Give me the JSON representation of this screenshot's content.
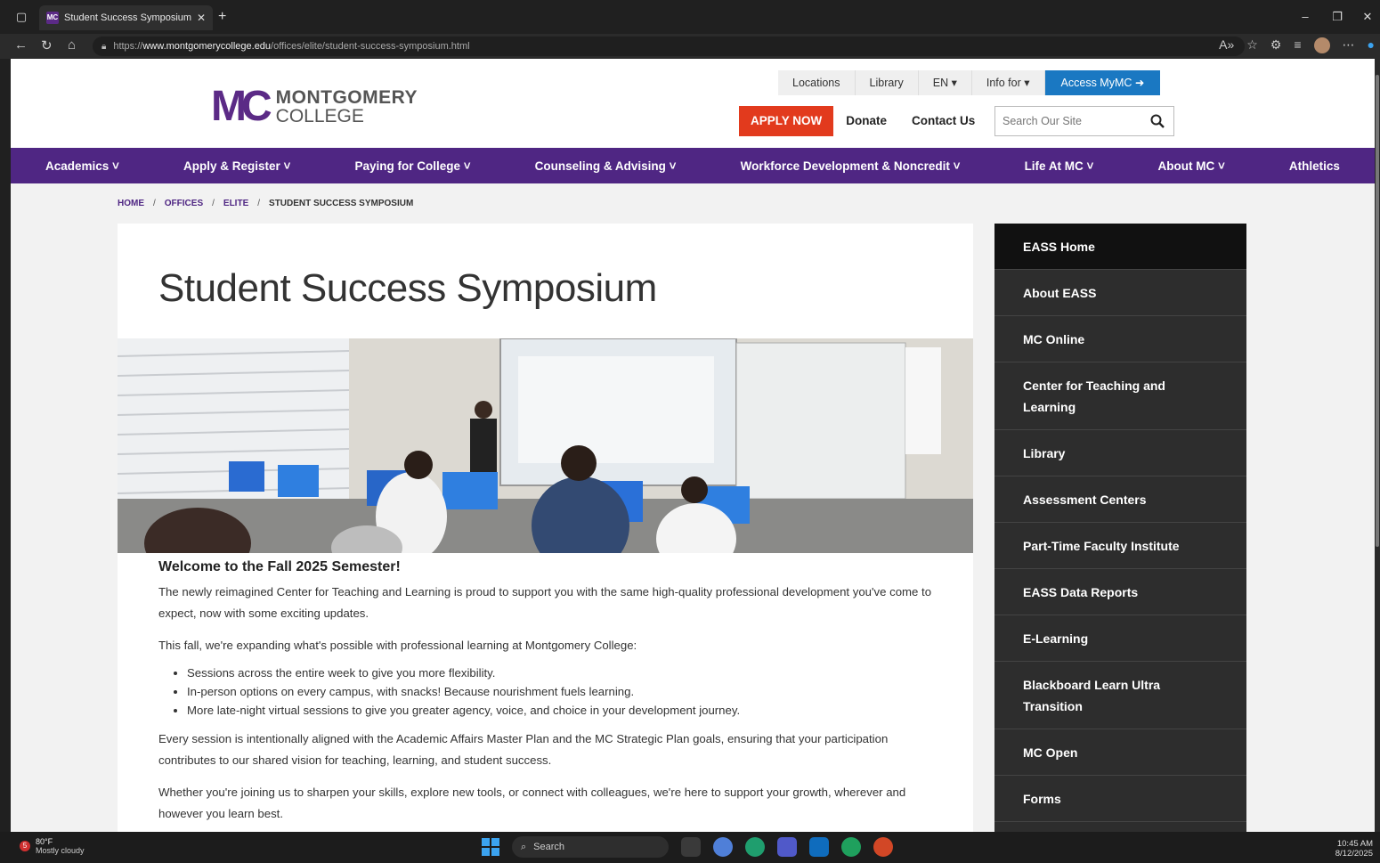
{
  "browser": {
    "tab_title": "Student Success Symposium | Mo",
    "url_prefix": "https://",
    "url_domain": "www.montgomerycollege.edu",
    "url_path": "/offices/elite/student-success-symposium.html"
  },
  "logo": {
    "mark": "MC",
    "line1": "MONTGOMERY",
    "line2": "COLLEGE"
  },
  "utility_nav": {
    "locations": "Locations",
    "library": "Library",
    "language": "EN ▾",
    "info_for": "Info for ▾",
    "access": "Access MyMC ➜"
  },
  "actions": {
    "apply": "APPLY NOW",
    "donate": "Donate",
    "contact": "Contact Us"
  },
  "search": {
    "placeholder": "Search Our Site"
  },
  "main_nav": [
    "Academics ˅",
    "Apply & Register ˅",
    "Paying for College ˅",
    "Counseling & Advising ˅",
    "Workforce Development & Noncredit ˅",
    "Life At MC ˅",
    "About MC ˅",
    "Athletics"
  ],
  "breadcrumb": {
    "home": "Home",
    "offices": "Offices",
    "elite": "ELITE",
    "current": "Student Success Symposium",
    "sep": "/"
  },
  "content": {
    "title": "Student Success Symposium",
    "heading": "Welcome to the Fall 2025 Semester!",
    "p1": "The newly reimagined Center for Teaching and Learning is proud to support you with the same high-quality professional development you've come to expect, now with some exciting updates.",
    "p2": "This fall, we're expanding what's possible with professional learning at Montgomery College:",
    "bullets": [
      "Sessions across the entire week to give you more flexibility.",
      "In-person options on every campus, with snacks! Because nourishment fuels learning.",
      "More late-night virtual sessions to give you greater agency, voice, and choice in your development journey."
    ],
    "p3": "Every session is intentionally aligned with the Academic Affairs Master Plan and the MC Strategic Plan goals, ensuring that your participation contributes to our shared vision for teaching, learning, and student success.",
    "p4": "Whether you're joining us to sharpen your skills, explore new tools, or connect with colleagues, we're here to support your growth, wherever and however you learn best."
  },
  "side_nav": [
    "EASS Home",
    "About EASS",
    "MC Online",
    "Center for Teaching and Learning",
    "Library",
    "Assessment Centers",
    "Part-Time Faculty Institute",
    "EASS Data Reports",
    "E-Learning",
    "Blackboard Learn Ultra Transition",
    "MC Open",
    "Forms"
  ],
  "taskbar": {
    "weather_badge": "5",
    "temp": "80°F",
    "condition": "Mostly cloudy",
    "search": "Search",
    "time": "10:45 AM",
    "date": "8/12/2025"
  },
  "colors": {
    "brand_purple": "#4f2683",
    "apply_red": "#e23a1d",
    "access_blue": "#1a78c2",
    "sidenav": "#2d2d2d"
  }
}
